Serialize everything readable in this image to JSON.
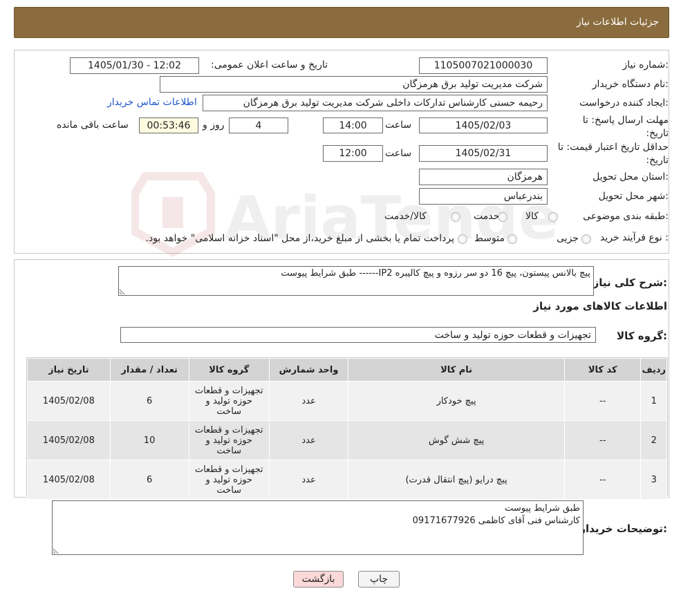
{
  "header": {
    "title": "جزئیات اطلاعات نیاز"
  },
  "watermark": "AriaTender.neT",
  "form": {
    "need_number_label": "شماره نیاز:",
    "need_number": "1105007021000030",
    "announce_label": "تاریخ و ساعت اعلان عمومی:",
    "announce_value": "1405/01/30 - 12:02",
    "buyer_org_label": "نام دستگاه خریدار:",
    "buyer_org": "شرکت مدیریت تولید برق هرمزگان",
    "creator_label": "ایجاد کننده درخواست:",
    "creator": "رحیمه حسنی کارشناس تداركات داخلی شرکت مدیریت تولید برق هرمزگان",
    "contact_link": "اطلاعات تماس خریدار",
    "reply_deadline_label_1": "مهلت ارسال پاسخ: تا",
    "reply_deadline_label_2": "تاریخ:",
    "reply_date": "1405/02/03",
    "time_label": "ساعت",
    "reply_time": "14:00",
    "days_value": "4",
    "days_label": "روز و",
    "remaining_time": "00:53:46",
    "remaining_label": "ساعت باقی مانده",
    "price_validity_label_1": "حداقل تاریخ اعتبار قیمت: تا",
    "price_validity_label_2": "تاریخ:",
    "price_date": "1405/02/31",
    "price_time": "12:00",
    "province_label": "استان محل تحویل:",
    "province": "هرمزگان",
    "city_label": "شهر محل تحویل:",
    "city": "بندرعباس",
    "category_label": "طبقه بندی موضوعی:",
    "category_options": [
      "کالا",
      "خدمت",
      "کالا/خدمت"
    ],
    "category_selected": "کالا",
    "process_label": "نوع فرآیند خرید :",
    "process_options": [
      "جزیی",
      "متوسط"
    ],
    "process_note": "پرداخت تمام یا بخشی از مبلغ خرید،از محل \"اسناد خزانه اسلامی\" خواهد بود."
  },
  "details": {
    "general_desc_label": "شرح کلی نیاز:",
    "general_desc": "پیچ بالانس پیستون، پیچ 16 دو سر رزوه و پیچ کالیبره IP2------ طبق شرایط پیوست",
    "goods_info_title": "اطلاعات کالاهای مورد نیاز",
    "goods_group_label": "گروه کالا:",
    "goods_group": "تجهیزات و قطعات حوزه تولید و ساخت"
  },
  "table": {
    "headers": [
      "ردیف",
      "کد کالا",
      "نام کالا",
      "واحد شمارش",
      "گروه کالا",
      "تعداد / مقدار",
      "تاریخ نیاز"
    ],
    "rows": [
      [
        "1",
        "--",
        "پیچ خودکار",
        "عدد",
        "تجهیزات و قطعات حوزه تولید و ساخت",
        "6",
        "1405/02/08"
      ],
      [
        "2",
        "--",
        "پیچ شش گوش",
        "عدد",
        "تجهیزات و قطعات حوزه تولید و ساخت",
        "10",
        "1405/02/08"
      ],
      [
        "3",
        "--",
        "پیچ درایو (پیچ انتقال قدرت)",
        "عدد",
        "تجهیزات و قطعات حوزه تولید و ساخت",
        "6",
        "1405/02/08"
      ]
    ]
  },
  "buyer_notes": {
    "label": "توضیحات خریدار:",
    "text": "طبق شرایط پیوست\nکارشناس فنی آقای کاظمی 09171677926"
  },
  "buttons": {
    "print": "چاپ",
    "back": "بازگشت"
  }
}
